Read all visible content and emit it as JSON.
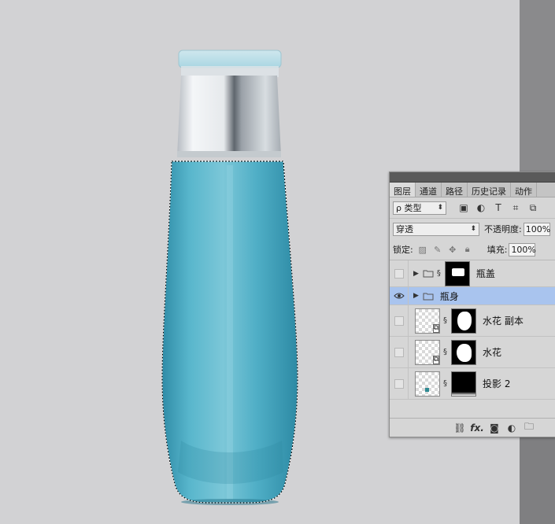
{
  "colors": {
    "canvas": "#d2d2d4",
    "panel": "#d6d6d6",
    "selected_layer": "#a9c4ee",
    "bottle_cyan": "#4aa7c0"
  },
  "panel": {
    "tabs": [
      "图层",
      "通道",
      "路径",
      "历史记录",
      "动作"
    ],
    "filter_label": "ρ 类型",
    "filter_icons": [
      "image-filter-icon",
      "adjustment-filter-icon",
      "type-filter-icon",
      "shape-filter-icon",
      "smart-object-filter-icon"
    ],
    "blend_mode": "穿透",
    "opacity_label": "不透明度:",
    "opacity_value": "100%",
    "lock_label": "锁定:",
    "fill_label": "填充:",
    "fill_value": "100%",
    "layers": [
      {
        "name": "瓶盖",
        "type": "group",
        "visible": false,
        "selected": false
      },
      {
        "name": "瓶身",
        "type": "group",
        "visible": true,
        "selected": true
      },
      {
        "name": "水花 副本",
        "type": "smart-object",
        "visible": false,
        "selected": false
      },
      {
        "name": "水花",
        "type": "smart-object",
        "visible": false,
        "selected": false
      },
      {
        "name": "投影 2",
        "type": "layer",
        "visible": false,
        "selected": false
      }
    ],
    "footer_icons": [
      "link-icon",
      "fx-icon",
      "add-mask-icon",
      "adjustment-icon",
      "new-group-icon"
    ],
    "footer_fx": "fx."
  }
}
